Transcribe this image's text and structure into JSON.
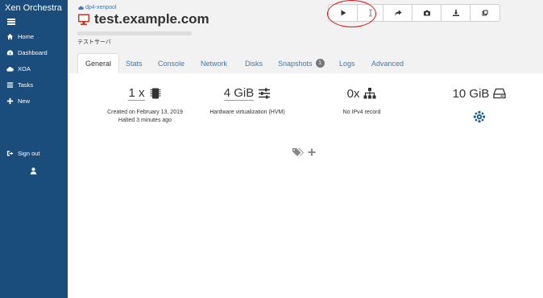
{
  "sidebar": {
    "brand": "Xen Orchestra",
    "items": [
      {
        "label": "Home",
        "icon": "home-icon"
      },
      {
        "label": "Dashboard",
        "icon": "dashboard-icon"
      },
      {
        "label": "XOA",
        "icon": "cloud-icon"
      },
      {
        "label": "Tasks",
        "icon": "tasks-icon"
      },
      {
        "label": "New",
        "icon": "plus-icon"
      }
    ],
    "signout": "Sign out"
  },
  "header": {
    "pool": "dp4-xenpool",
    "vm_name": "test.example.com",
    "vm_description": "テストサーバ",
    "actions": [
      "start",
      "cursor",
      "migrate",
      "snapshot",
      "export",
      "copy"
    ]
  },
  "tabs": [
    {
      "label": "General",
      "active": true
    },
    {
      "label": "Stats"
    },
    {
      "label": "Console"
    },
    {
      "label": "Network"
    },
    {
      "label": "Disks"
    },
    {
      "label": "Snapshots",
      "badge": "1"
    },
    {
      "label": "Logs"
    },
    {
      "label": "Advanced"
    }
  ],
  "general": {
    "cpu": {
      "value": "1 x",
      "line1": "Created on February 13, 2019",
      "line2": "Halted 3 minutes ago"
    },
    "memory": {
      "value": "4 GiB",
      "line1": "Hardware virtualization (HVM)"
    },
    "network": {
      "value": "0x",
      "line1": "No IPv4 record"
    },
    "disk": {
      "value": "10 GiB"
    }
  },
  "colors": {
    "sidebar": "#1a4d7c",
    "link": "#3a7ab8",
    "highlight": "#dd1111"
  }
}
